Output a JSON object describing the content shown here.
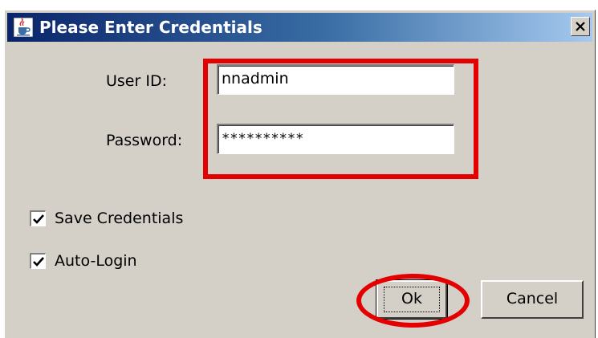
{
  "dialog": {
    "title": "Please Enter Credentials",
    "icon": "java-cup-icon",
    "close_label": "✕"
  },
  "form": {
    "user_id_label": "User ID:",
    "user_id_value": "nnadmin",
    "password_label": "Password:",
    "password_value": "**********"
  },
  "options": {
    "save_credentials_label": "Save Credentials",
    "save_credentials_checked": true,
    "auto_login_label": "Auto-Login",
    "auto_login_checked": true
  },
  "buttons": {
    "ok_label": "Ok",
    "cancel_label": "Cancel"
  },
  "annotations": {
    "highlight_color": "#e40000"
  }
}
